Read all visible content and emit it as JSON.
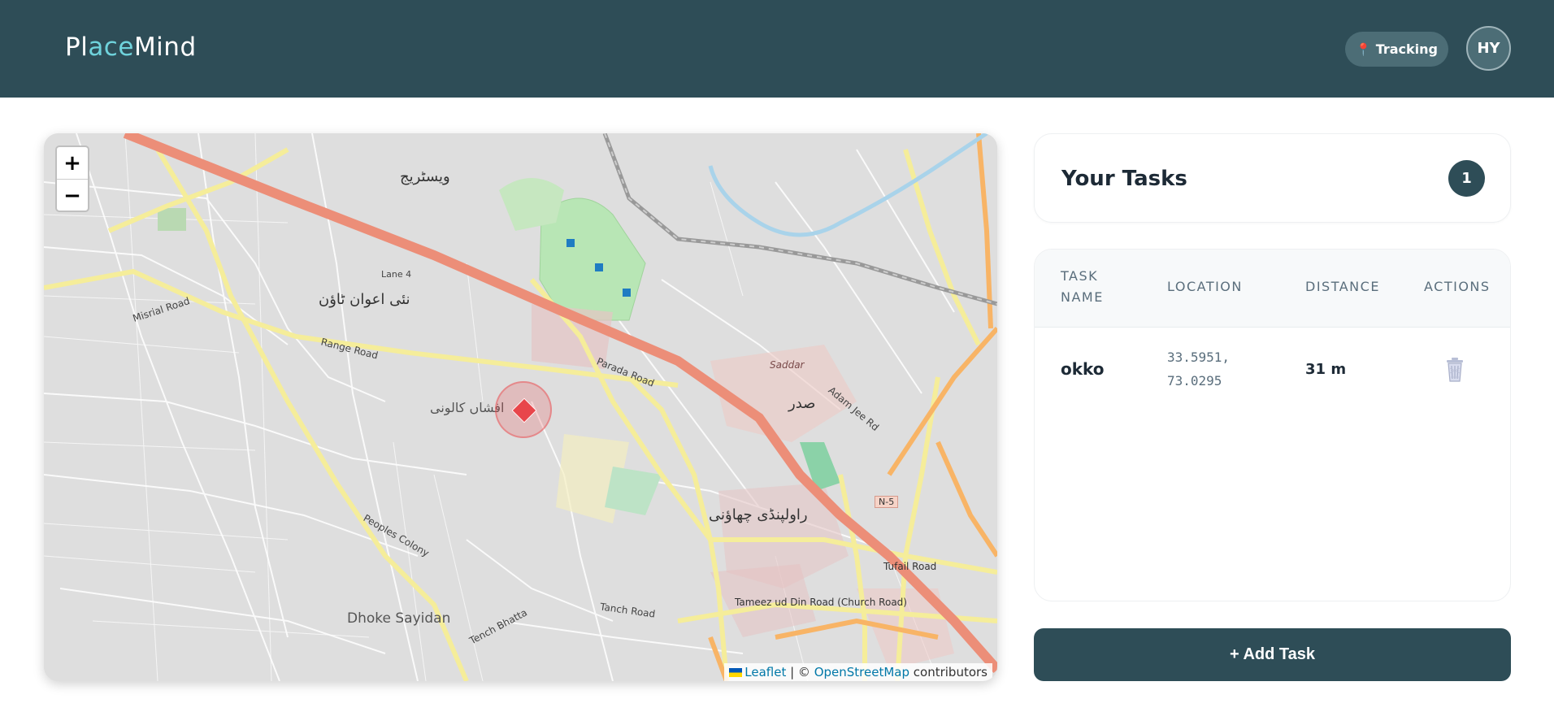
{
  "header": {
    "logo_prefix": "Pl",
    "logo_accent": "ace",
    "logo_suffix": "Mind",
    "tracking_label": "Tracking",
    "avatar_initials": "HY"
  },
  "map": {
    "zoom_in": "+",
    "zoom_out": "−",
    "labels": {
      "dhoke_sayidan": "Dhoke Sayidan",
      "saddar": "Saddar",
      "lane4": "Lane 4",
      "range_road": "Range Road",
      "parada_road": "Parada Road",
      "misrial_road": "Misrial Road",
      "peoples_colony": "Peoples Colony",
      "tufail_road": "Tufail Road",
      "tameez_road": "Tameez ud Din Road (Church Road)",
      "tanch_road": "Tanch Road",
      "tench_bhatta": "Tench Bhatta",
      "adam_jee_rd": "Adam Jee Rd",
      "n5": "N-5",
      "urdu_rawalpindi_cantt": "راولپنڈی چھاؤنی",
      "urdu_sadar": "صدر",
      "urdu_westridge": "ویسٹریج",
      "urdu_nai_awan": "نئی اعوان ٹاؤن",
      "urdu_afshan": "افشاں کالونی"
    },
    "attribution_leaflet": "Leaflet",
    "attribution_sep": " | © ",
    "attribution_osm": "OpenStreetMap",
    "attribution_suffix": " contributors"
  },
  "tasks": {
    "title": "Your Tasks",
    "count": "1",
    "columns": {
      "name_1": "TASK",
      "name_2": "NAME",
      "location": "LOCATION",
      "distance": "DISTANCE",
      "actions": "ACTIONS"
    },
    "rows": [
      {
        "name": "okko",
        "lat": "33.5951,",
        "lng": "73.0295",
        "distance": "31 m"
      }
    ],
    "add_button": "+ Add Task"
  },
  "colors": {
    "header_bg": "#2e4d57",
    "accent": "#6fd3dc",
    "marker": "#e8464b"
  }
}
